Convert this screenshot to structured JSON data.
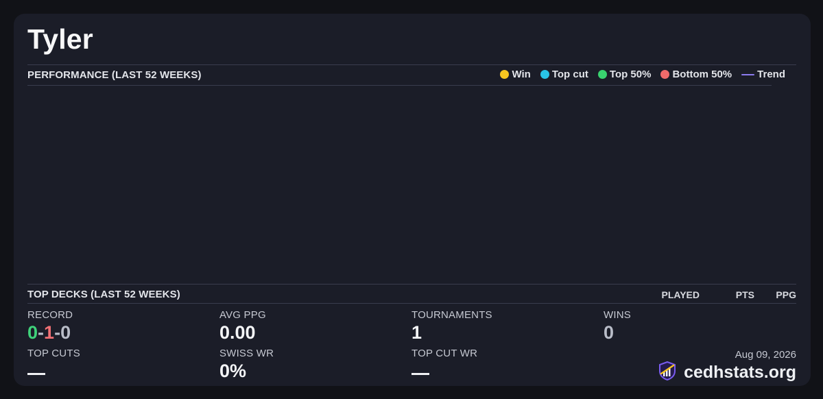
{
  "player": {
    "name": "Tyler"
  },
  "performance": {
    "title": "PERFORMANCE (LAST 52 WEEKS)",
    "legend": [
      {
        "label": "Win",
        "type": "dot",
        "color": "#f6c520"
      },
      {
        "label": "Top cut",
        "type": "dot",
        "color": "#29c3e6"
      },
      {
        "label": "Top 50%",
        "type": "dot",
        "color": "#39d26f"
      },
      {
        "label": "Bottom 50%",
        "type": "dot",
        "color": "#f06b6b"
      },
      {
        "label": "Trend",
        "type": "line",
        "color": "#8c7cf0"
      }
    ]
  },
  "chart_data": {
    "type": "scatter",
    "title": "PERFORMANCE (LAST 52 WEEKS)",
    "series": [
      {
        "name": "Win",
        "values": []
      },
      {
        "name": "Top cut",
        "values": []
      },
      {
        "name": "Top 50%",
        "values": []
      },
      {
        "name": "Bottom 50%",
        "values": []
      },
      {
        "name": "Trend",
        "values": []
      }
    ]
  },
  "top_decks": {
    "title": "TOP DECKS (LAST 52 WEEKS)",
    "columns": [
      "PLAYED",
      "PTS",
      "PPG"
    ],
    "rows": []
  },
  "stats": {
    "record": {
      "label": "RECORD",
      "wins": "0",
      "losses": "1",
      "draws": "0",
      "sep": "-"
    },
    "avg_ppg": {
      "label": "AVG PPG",
      "value": "0.00"
    },
    "tournaments": {
      "label": "TOURNAMENTS",
      "value": "1"
    },
    "wins": {
      "label": "WINS",
      "value": "0"
    },
    "top_cuts": {
      "label": "TOP CUTS",
      "value": "—"
    },
    "swiss_wr": {
      "label": "SWISS WR",
      "value": "0%"
    },
    "top_cut_wr": {
      "label": "TOP CUT WR",
      "value": "—"
    }
  },
  "colors": {
    "record_win": "#3fd27a",
    "record_loss": "#f07074",
    "record_draw": "#b9bdc8"
  },
  "footer": {
    "date": "Aug 09, 2026",
    "brand": "cedhstats.org",
    "logo_icon": "chart-shield-icon"
  }
}
